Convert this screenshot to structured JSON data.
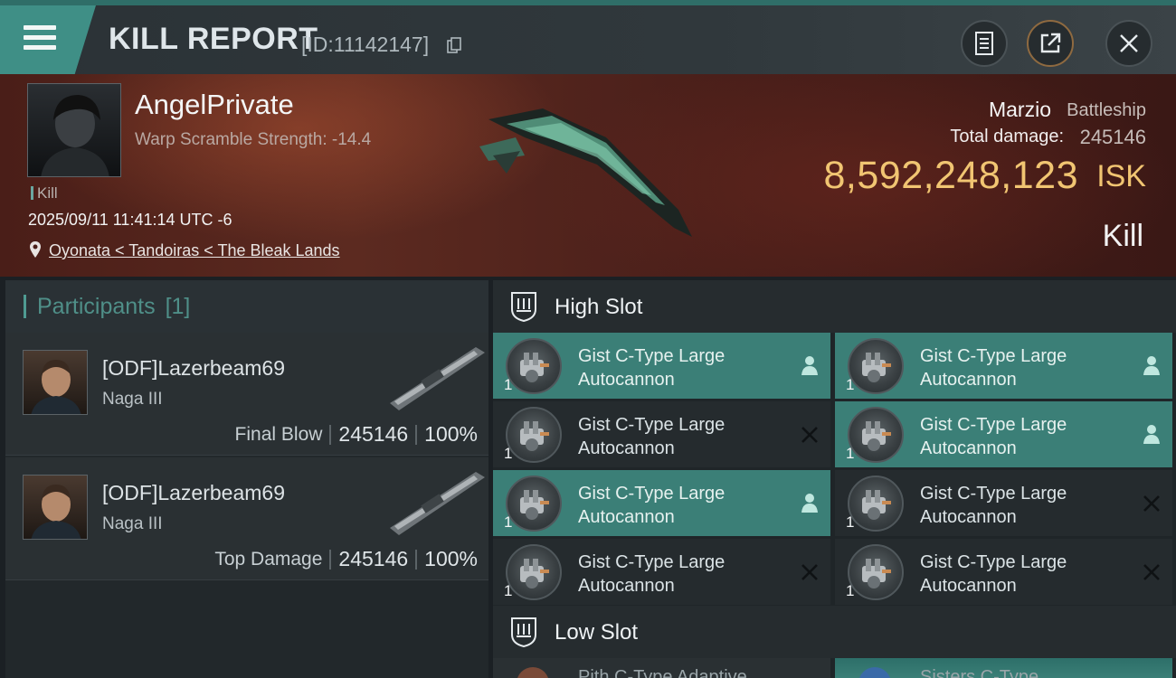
{
  "header": {
    "title": "KILL REPORT",
    "report_id": "[ID:11142147]",
    "buttons": [
      "clipboard-icon",
      "share-icon",
      "close-icon"
    ],
    "accent": "#3f8f86"
  },
  "victim": {
    "name": "AngelPrivate",
    "warp_scramble": "Warp Scramble Strength: -14.4",
    "tag": "Kill",
    "datetime": "2025/09/11 11:41:14 UTC -6",
    "location": "Oyonata < Tandoiras < The Bleak Lands",
    "ship_name": "Marzio",
    "ship_class": "Battleship",
    "total_damage_label": "Total damage:",
    "total_damage": "245146",
    "isk_value": "8,592,248,123",
    "isk_unit": "ISK",
    "kill_type": "Kill"
  },
  "participants": {
    "title": "Participants",
    "count": "[1]",
    "rows": [
      {
        "name": "[ODF]Lazerbeam69",
        "ship": "Naga III",
        "label": "Final Blow",
        "damage": "245146",
        "percent": "100%"
      },
      {
        "name": "[ODF]Lazerbeam69",
        "ship": "Naga III",
        "label": "Top Damage",
        "damage": "245146",
        "percent": "100%"
      }
    ]
  },
  "slots": {
    "high_slot": {
      "label": "High Slot",
      "modules": [
        {
          "line1": "Gist C-Type Large",
          "line2": "Autocannon",
          "qty": "1",
          "state": "dropped"
        },
        {
          "line1": "Gist C-Type Large",
          "line2": "Autocannon",
          "qty": "1",
          "state": "dropped"
        },
        {
          "line1": "Gist C-Type Large",
          "line2": "Autocannon",
          "qty": "1",
          "state": "destroyed"
        },
        {
          "line1": "Gist C-Type Large",
          "line2": "Autocannon",
          "qty": "1",
          "state": "dropped"
        },
        {
          "line1": "Gist C-Type Large",
          "line2": "Autocannon",
          "qty": "1",
          "state": "dropped"
        },
        {
          "line1": "Gist C-Type Large",
          "line2": "Autocannon",
          "qty": "1",
          "state": "destroyed"
        },
        {
          "line1": "Gist C-Type Large",
          "line2": "Autocannon",
          "qty": "1",
          "state": "destroyed"
        },
        {
          "line1": "Gist C-Type Large",
          "line2": "Autocannon",
          "qty": "1",
          "state": "destroyed"
        }
      ]
    },
    "low_slot": {
      "label": "Low Slot",
      "partial_items": [
        "Pith C-Type Adaptive",
        "Sisters C-Type"
      ]
    }
  }
}
